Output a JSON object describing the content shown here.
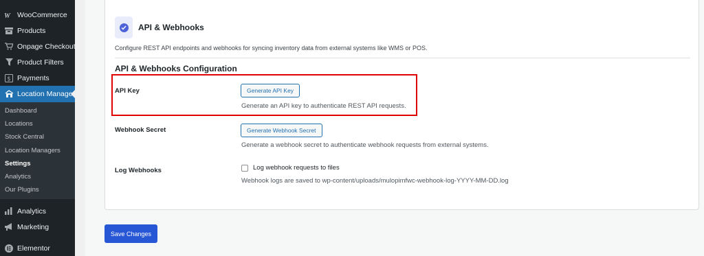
{
  "sidebar": {
    "items": [
      {
        "label": "WooCommerce",
        "icon": "woo-icon"
      },
      {
        "label": "Products",
        "icon": "archive-icon"
      },
      {
        "label": "Onpage Checkout",
        "icon": "cart-icon"
      },
      {
        "label": "Product Filters",
        "icon": "filter-icon"
      },
      {
        "label": "Payments",
        "icon": "dollar-icon"
      },
      {
        "label": "Location Manage",
        "icon": "store-icon"
      }
    ],
    "submenu": [
      "Dashboard",
      "Locations",
      "Stock Central",
      "Location Managers",
      "Settings",
      "Analytics",
      "Our Plugins"
    ],
    "bottom_items": [
      {
        "label": "Analytics",
        "icon": "bar-chart-icon"
      },
      {
        "label": "Marketing",
        "icon": "megaphone-icon"
      },
      {
        "label": "Elementor",
        "icon": "elementor-icon"
      }
    ]
  },
  "card": {
    "title": "API & Webhooks",
    "description": "Configure REST API endpoints and webhooks for syncing inventory data from external systems like WMS or POS.",
    "section_title": "API & Webhooks Configuration"
  },
  "fields": {
    "api_key": {
      "label": "API Key",
      "button": "Generate API Key",
      "help": "Generate an API key to authenticate REST API requests."
    },
    "webhook_secret": {
      "label": "Webhook Secret",
      "button": "Generate Webhook Secret",
      "help": "Generate a webhook secret to authenticate webhook requests from external systems."
    },
    "log_webhooks": {
      "label": "Log Webhooks",
      "checkbox_label": "Log webhook requests to files",
      "checked": false,
      "help": "Webhook logs are saved to wp-content/uploads/mulopimfwc-webhook-log-YYYY-MM-DD.log"
    }
  },
  "save_button": "Save Changes",
  "colors": {
    "sidebar_bg": "#1d2327",
    "active_blue": "#2271b1",
    "primary_button": "#2857d6",
    "highlight_red": "#e00000"
  }
}
